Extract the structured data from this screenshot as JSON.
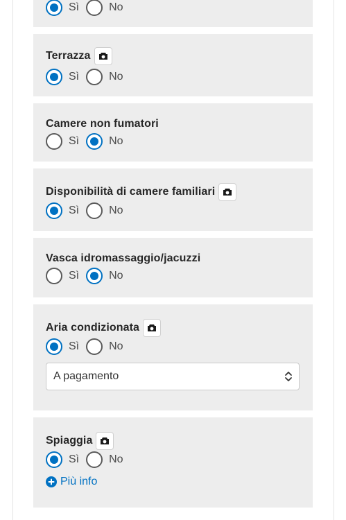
{
  "options": {
    "yes": "Sì",
    "no": "No"
  },
  "sections": [
    {
      "title": "",
      "selected": "yes"
    },
    {
      "title": "Terrazza",
      "selected": "yes",
      "has_photo": true
    },
    {
      "title": "Camere non fumatori",
      "selected": "no"
    },
    {
      "title": "Disponibilità di camere familiari",
      "selected": "yes",
      "has_photo": true
    },
    {
      "title": "Vasca idromassaggio/jacuzzi",
      "selected": "no"
    },
    {
      "title": "Aria condizionata",
      "selected": "yes",
      "has_photo": true,
      "select_value": "A pagamento"
    },
    {
      "title": "Spiaggia",
      "selected": "yes",
      "has_photo": true,
      "link": "Più info"
    }
  ],
  "colors": {
    "accent": "#0071c2",
    "card_bg": "#ededed"
  },
  "icons": {
    "photo": "camera-icon",
    "select": "chevron-up-down-icon",
    "info": "plus-circle-icon"
  }
}
